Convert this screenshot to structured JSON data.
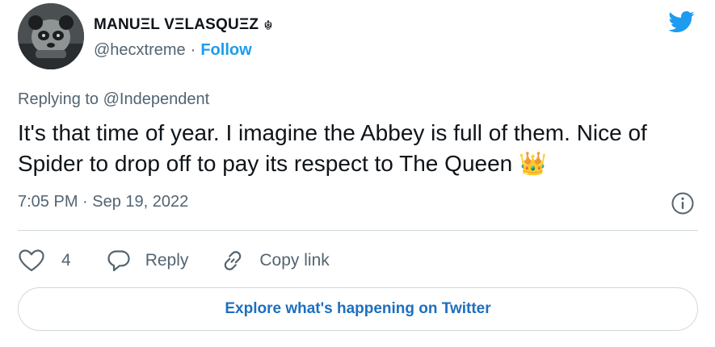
{
  "author": {
    "display_name": "MANUΞL VΞLASQUΞZ",
    "name_emoji": "☬",
    "handle": "@hecxtreme",
    "separator": "·",
    "follow_label": "Follow"
  },
  "tweet": {
    "replying_prefix": "Replying to",
    "replying_to": "@Independent",
    "text": "It's that time of year. I imagine the Abbey is full of them. Nice of Spider to drop off to pay its respect to The Queen",
    "emoji": "👑",
    "timestamp": "7:05 PM · Sep 19, 2022"
  },
  "actions": {
    "like_count": "4",
    "reply_label": "Reply",
    "copy_link_label": "Copy link"
  },
  "explore_label": "Explore what's happening on Twitter",
  "colors": {
    "accent": "#1d9bf0",
    "secondary_text": "#536471",
    "border": "#cfd9de"
  },
  "icons": [
    "twitter-bird-icon",
    "info-icon",
    "heart-icon",
    "reply-bubble-icon",
    "link-icon"
  ]
}
